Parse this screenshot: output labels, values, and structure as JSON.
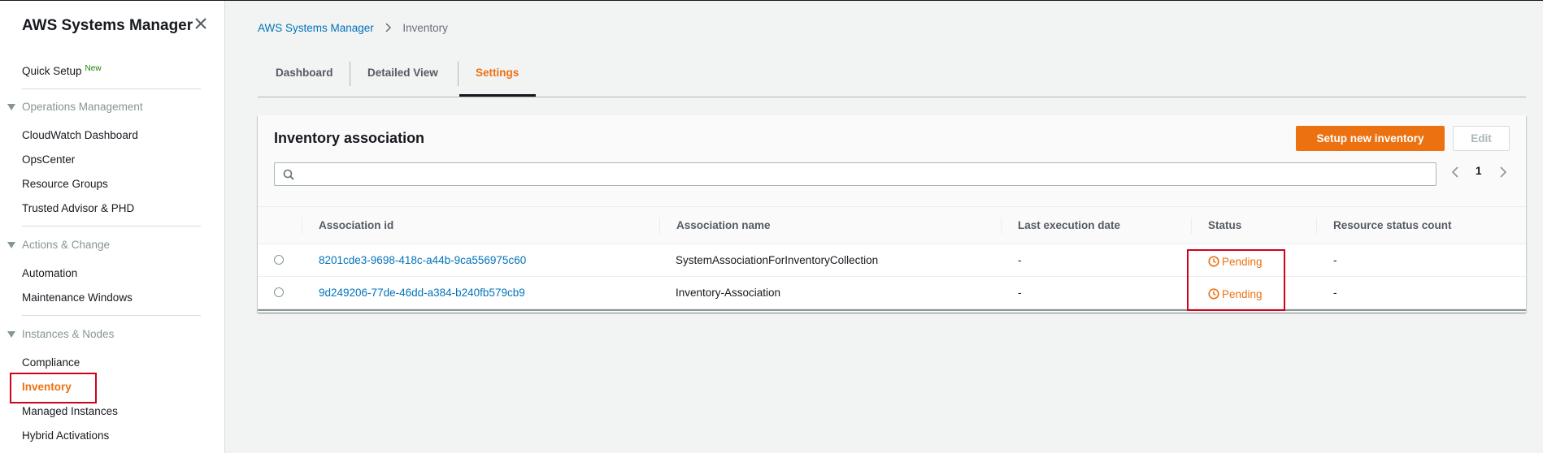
{
  "sidebar": {
    "title": "AWS Systems Manager",
    "quick_setup": "Quick Setup",
    "quick_setup_badge": "New",
    "sections": [
      {
        "label": "Operations Management",
        "items": [
          "CloudWatch Dashboard",
          "OpsCenter",
          "Resource Groups",
          "Trusted Advisor & PHD"
        ]
      },
      {
        "label": "Actions & Change",
        "items": [
          "Automation",
          "Maintenance Windows"
        ]
      },
      {
        "label": "Instances & Nodes",
        "items": [
          "Compliance",
          "Inventory",
          "Managed Instances",
          "Hybrid Activations"
        ]
      }
    ],
    "active_item": "Inventory"
  },
  "breadcrumb": {
    "root": "AWS Systems Manager",
    "current": "Inventory"
  },
  "tabs": [
    "Dashboard",
    "Detailed View",
    "Settings"
  ],
  "active_tab": "Settings",
  "panel": {
    "title": "Inventory association",
    "setup_button": "Setup new inventory",
    "edit_button": "Edit",
    "search_placeholder": "",
    "page": "1"
  },
  "table": {
    "columns": [
      "Association id",
      "Association name",
      "Last execution date",
      "Status",
      "Resource status count"
    ],
    "rows": [
      {
        "id": "8201cde3-9698-418c-a44b-9ca556975c60",
        "name": "SystemAssociationForInventoryCollection",
        "last_exec": "-",
        "status": "Pending",
        "resource_count": "-"
      },
      {
        "id": "9d249206-77de-46dd-a384-b240fb579cb9",
        "name": "Inventory-Association",
        "last_exec": "-",
        "status": "Pending",
        "resource_count": "-"
      }
    ]
  },
  "colors": {
    "accent": "#ec7211",
    "link": "#0073bb",
    "highlight": "#d0021b"
  }
}
